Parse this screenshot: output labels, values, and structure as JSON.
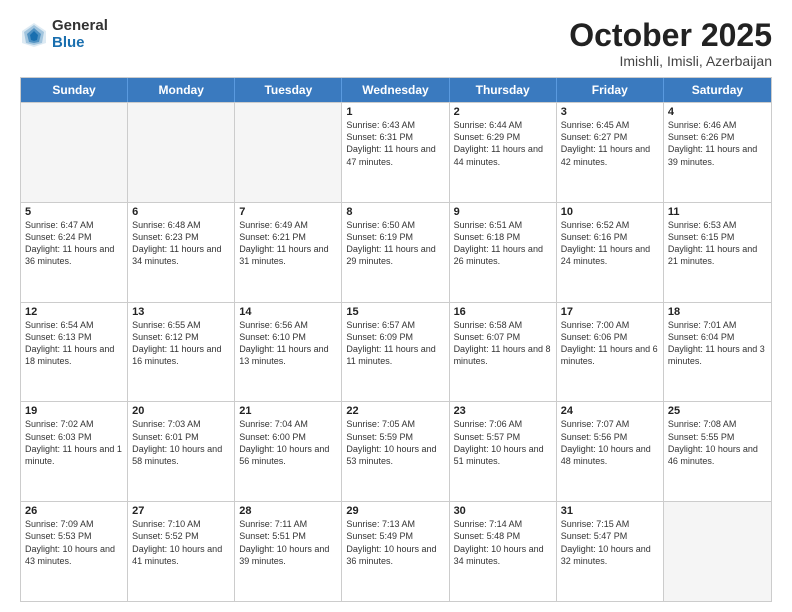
{
  "logo": {
    "general": "General",
    "blue": "Blue"
  },
  "header": {
    "month": "October 2025",
    "location": "Imishli, Imisli, Azerbaijan"
  },
  "weekdays": [
    "Sunday",
    "Monday",
    "Tuesday",
    "Wednesday",
    "Thursday",
    "Friday",
    "Saturday"
  ],
  "rows": [
    [
      {
        "day": "",
        "empty": true
      },
      {
        "day": "",
        "empty": true
      },
      {
        "day": "",
        "empty": true
      },
      {
        "day": "1",
        "sunrise": "Sunrise: 6:43 AM",
        "sunset": "Sunset: 6:31 PM",
        "daylight": "Daylight: 11 hours and 47 minutes."
      },
      {
        "day": "2",
        "sunrise": "Sunrise: 6:44 AM",
        "sunset": "Sunset: 6:29 PM",
        "daylight": "Daylight: 11 hours and 44 minutes."
      },
      {
        "day": "3",
        "sunrise": "Sunrise: 6:45 AM",
        "sunset": "Sunset: 6:27 PM",
        "daylight": "Daylight: 11 hours and 42 minutes."
      },
      {
        "day": "4",
        "sunrise": "Sunrise: 6:46 AM",
        "sunset": "Sunset: 6:26 PM",
        "daylight": "Daylight: 11 hours and 39 minutes."
      }
    ],
    [
      {
        "day": "5",
        "sunrise": "Sunrise: 6:47 AM",
        "sunset": "Sunset: 6:24 PM",
        "daylight": "Daylight: 11 hours and 36 minutes."
      },
      {
        "day": "6",
        "sunrise": "Sunrise: 6:48 AM",
        "sunset": "Sunset: 6:23 PM",
        "daylight": "Daylight: 11 hours and 34 minutes."
      },
      {
        "day": "7",
        "sunrise": "Sunrise: 6:49 AM",
        "sunset": "Sunset: 6:21 PM",
        "daylight": "Daylight: 11 hours and 31 minutes."
      },
      {
        "day": "8",
        "sunrise": "Sunrise: 6:50 AM",
        "sunset": "Sunset: 6:19 PM",
        "daylight": "Daylight: 11 hours and 29 minutes."
      },
      {
        "day": "9",
        "sunrise": "Sunrise: 6:51 AM",
        "sunset": "Sunset: 6:18 PM",
        "daylight": "Daylight: 11 hours and 26 minutes."
      },
      {
        "day": "10",
        "sunrise": "Sunrise: 6:52 AM",
        "sunset": "Sunset: 6:16 PM",
        "daylight": "Daylight: 11 hours and 24 minutes."
      },
      {
        "day": "11",
        "sunrise": "Sunrise: 6:53 AM",
        "sunset": "Sunset: 6:15 PM",
        "daylight": "Daylight: 11 hours and 21 minutes."
      }
    ],
    [
      {
        "day": "12",
        "sunrise": "Sunrise: 6:54 AM",
        "sunset": "Sunset: 6:13 PM",
        "daylight": "Daylight: 11 hours and 18 minutes."
      },
      {
        "day": "13",
        "sunrise": "Sunrise: 6:55 AM",
        "sunset": "Sunset: 6:12 PM",
        "daylight": "Daylight: 11 hours and 16 minutes."
      },
      {
        "day": "14",
        "sunrise": "Sunrise: 6:56 AM",
        "sunset": "Sunset: 6:10 PM",
        "daylight": "Daylight: 11 hours and 13 minutes."
      },
      {
        "day": "15",
        "sunrise": "Sunrise: 6:57 AM",
        "sunset": "Sunset: 6:09 PM",
        "daylight": "Daylight: 11 hours and 11 minutes."
      },
      {
        "day": "16",
        "sunrise": "Sunrise: 6:58 AM",
        "sunset": "Sunset: 6:07 PM",
        "daylight": "Daylight: 11 hours and 8 minutes."
      },
      {
        "day": "17",
        "sunrise": "Sunrise: 7:00 AM",
        "sunset": "Sunset: 6:06 PM",
        "daylight": "Daylight: 11 hours and 6 minutes."
      },
      {
        "day": "18",
        "sunrise": "Sunrise: 7:01 AM",
        "sunset": "Sunset: 6:04 PM",
        "daylight": "Daylight: 11 hours and 3 minutes."
      }
    ],
    [
      {
        "day": "19",
        "sunrise": "Sunrise: 7:02 AM",
        "sunset": "Sunset: 6:03 PM",
        "daylight": "Daylight: 11 hours and 1 minute."
      },
      {
        "day": "20",
        "sunrise": "Sunrise: 7:03 AM",
        "sunset": "Sunset: 6:01 PM",
        "daylight": "Daylight: 10 hours and 58 minutes."
      },
      {
        "day": "21",
        "sunrise": "Sunrise: 7:04 AM",
        "sunset": "Sunset: 6:00 PM",
        "daylight": "Daylight: 10 hours and 56 minutes."
      },
      {
        "day": "22",
        "sunrise": "Sunrise: 7:05 AM",
        "sunset": "Sunset: 5:59 PM",
        "daylight": "Daylight: 10 hours and 53 minutes."
      },
      {
        "day": "23",
        "sunrise": "Sunrise: 7:06 AM",
        "sunset": "Sunset: 5:57 PM",
        "daylight": "Daylight: 10 hours and 51 minutes."
      },
      {
        "day": "24",
        "sunrise": "Sunrise: 7:07 AM",
        "sunset": "Sunset: 5:56 PM",
        "daylight": "Daylight: 10 hours and 48 minutes."
      },
      {
        "day": "25",
        "sunrise": "Sunrise: 7:08 AM",
        "sunset": "Sunset: 5:55 PM",
        "daylight": "Daylight: 10 hours and 46 minutes."
      }
    ],
    [
      {
        "day": "26",
        "sunrise": "Sunrise: 7:09 AM",
        "sunset": "Sunset: 5:53 PM",
        "daylight": "Daylight: 10 hours and 43 minutes."
      },
      {
        "day": "27",
        "sunrise": "Sunrise: 7:10 AM",
        "sunset": "Sunset: 5:52 PM",
        "daylight": "Daylight: 10 hours and 41 minutes."
      },
      {
        "day": "28",
        "sunrise": "Sunrise: 7:11 AM",
        "sunset": "Sunset: 5:51 PM",
        "daylight": "Daylight: 10 hours and 39 minutes."
      },
      {
        "day": "29",
        "sunrise": "Sunrise: 7:13 AM",
        "sunset": "Sunset: 5:49 PM",
        "daylight": "Daylight: 10 hours and 36 minutes."
      },
      {
        "day": "30",
        "sunrise": "Sunrise: 7:14 AM",
        "sunset": "Sunset: 5:48 PM",
        "daylight": "Daylight: 10 hours and 34 minutes."
      },
      {
        "day": "31",
        "sunrise": "Sunrise: 7:15 AM",
        "sunset": "Sunset: 5:47 PM",
        "daylight": "Daylight: 10 hours and 32 minutes."
      },
      {
        "day": "",
        "empty": true
      }
    ]
  ]
}
